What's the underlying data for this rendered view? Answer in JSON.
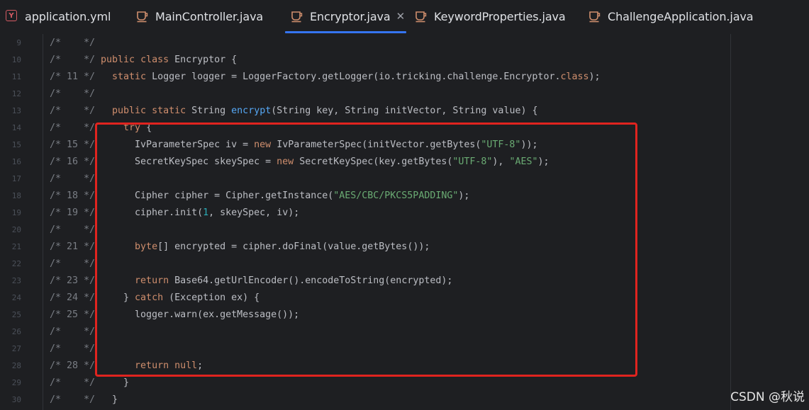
{
  "tabs": [
    {
      "label": "application.yml",
      "icon": "yaml-file-icon",
      "active": false
    },
    {
      "label": "MainController.java",
      "icon": "java-class-icon",
      "active": false
    },
    {
      "label": "Encryptor.java",
      "icon": "java-class-icon",
      "active": true,
      "close": "✕"
    },
    {
      "label": "KeywordProperties.java",
      "icon": "java-class-icon",
      "active": false
    },
    {
      "label": "ChallengeApplication.java",
      "icon": "java-class-icon",
      "active": false
    }
  ],
  "lines": [
    {
      "num": "9",
      "comment": "/*    */",
      "code": ""
    },
    {
      "num": "10",
      "comment": "/*    */",
      "code": "public class Encryptor {"
    },
    {
      "num": "11",
      "comment": "/* 11 */",
      "code": "  static Logger logger = LoggerFactory.getLogger(io.tricking.challenge.Encryptor.class);"
    },
    {
      "num": "12",
      "comment": "/*    */",
      "code": ""
    },
    {
      "num": "13",
      "comment": "/*    */",
      "code": "  public static String encrypt(String key, String initVector, String value) {"
    },
    {
      "num": "14",
      "comment": "/*    */",
      "code": "    try {"
    },
    {
      "num": "15",
      "comment": "/* 15 */",
      "code": "      IvParameterSpec iv = new IvParameterSpec(initVector.getBytes(\"UTF-8\"));"
    },
    {
      "num": "16",
      "comment": "/* 16 */",
      "code": "      SecretKeySpec skeySpec = new SecretKeySpec(key.getBytes(\"UTF-8\"), \"AES\");"
    },
    {
      "num": "17",
      "comment": "/*    */",
      "code": ""
    },
    {
      "num": "18",
      "comment": "/* 18 */",
      "code": "      Cipher cipher = Cipher.getInstance(\"AES/CBC/PKCS5PADDING\");"
    },
    {
      "num": "19",
      "comment": "/* 19 */",
      "code": "      cipher.init(1, skeySpec, iv);"
    },
    {
      "num": "20",
      "comment": "/*    */",
      "code": ""
    },
    {
      "num": "21",
      "comment": "/* 21 */",
      "code": "      byte[] encrypted = cipher.doFinal(value.getBytes());"
    },
    {
      "num": "22",
      "comment": "/*    */",
      "code": ""
    },
    {
      "num": "23",
      "comment": "/* 23 */",
      "code": "      return Base64.getUrlEncoder().encodeToString(encrypted);"
    },
    {
      "num": "24",
      "comment": "/* 24 */",
      "code": "    } catch (Exception ex) {"
    },
    {
      "num": "25",
      "comment": "/* 25 */",
      "code": "      logger.warn(ex.getMessage());"
    },
    {
      "num": "26",
      "comment": "/*    */",
      "code": ""
    },
    {
      "num": "27",
      "comment": "/*    */",
      "code": ""
    },
    {
      "num": "28",
      "comment": "/* 28 */",
      "code": "      return null;"
    },
    {
      "num": "29",
      "comment": "/*    */",
      "code": "    }"
    },
    {
      "num": "30",
      "comment": "/*    */",
      "code": "  }"
    }
  ],
  "watermark": "CSDN @秋说",
  "colors": {
    "background": "#1e1f22",
    "keyword": "#cf8e6d",
    "string": "#6aab73",
    "number": "#2aacb8",
    "method_declaration": "#56a8f5",
    "default_text": "#bcbec4",
    "comment": "#7a7e85",
    "active_tab_underline": "#3574f0",
    "annotation_box": "#e0241f"
  }
}
